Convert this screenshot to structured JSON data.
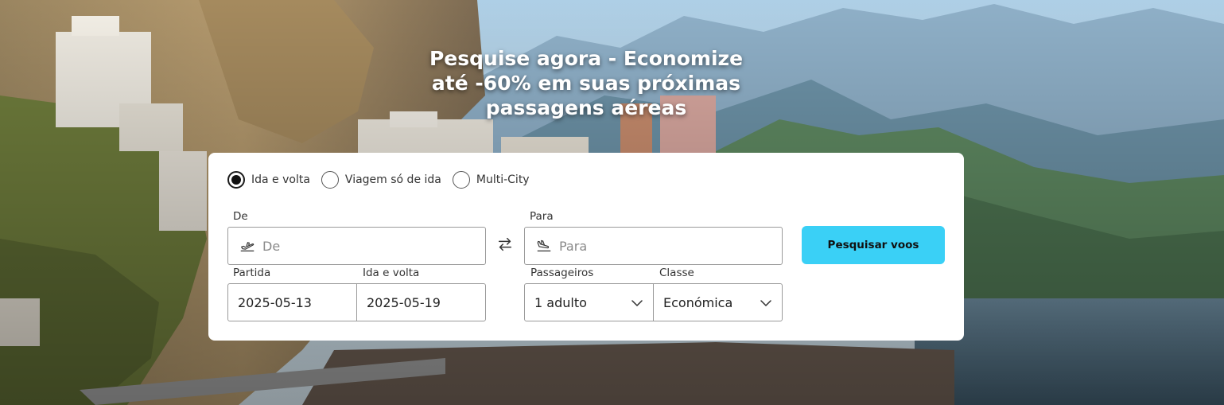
{
  "hero": {
    "headline": [
      "Pesquise agora - Economize",
      "até -60% em suas próximas",
      "passagens aéreas"
    ]
  },
  "search": {
    "trip_types": [
      {
        "label": "Ida e volta",
        "checked": true
      },
      {
        "label": "Viagem só de ida",
        "checked": false
      },
      {
        "label": "Multi-City",
        "checked": false
      }
    ],
    "from": {
      "label": "De",
      "placeholder": "De"
    },
    "to": {
      "label": "Para",
      "placeholder": "Para"
    },
    "departure": {
      "label": "Partida",
      "value": "2025-05-13"
    },
    "return": {
      "label": "Ida e volta",
      "value": "2025-05-19"
    },
    "passengers": {
      "label": "Passageiros",
      "value": "1 adulto"
    },
    "cabin_class": {
      "label": "Classe",
      "value": "Económica"
    },
    "submit_label": "Pesquisar voos"
  },
  "colors": {
    "accent": "#3ad0f6",
    "card_background": "#ffffff"
  },
  "icons": {
    "from": "takeoff-icon",
    "to": "landing-icon",
    "swap": "swap-arrows-icon",
    "dropdown": "chevron-down-icon"
  }
}
